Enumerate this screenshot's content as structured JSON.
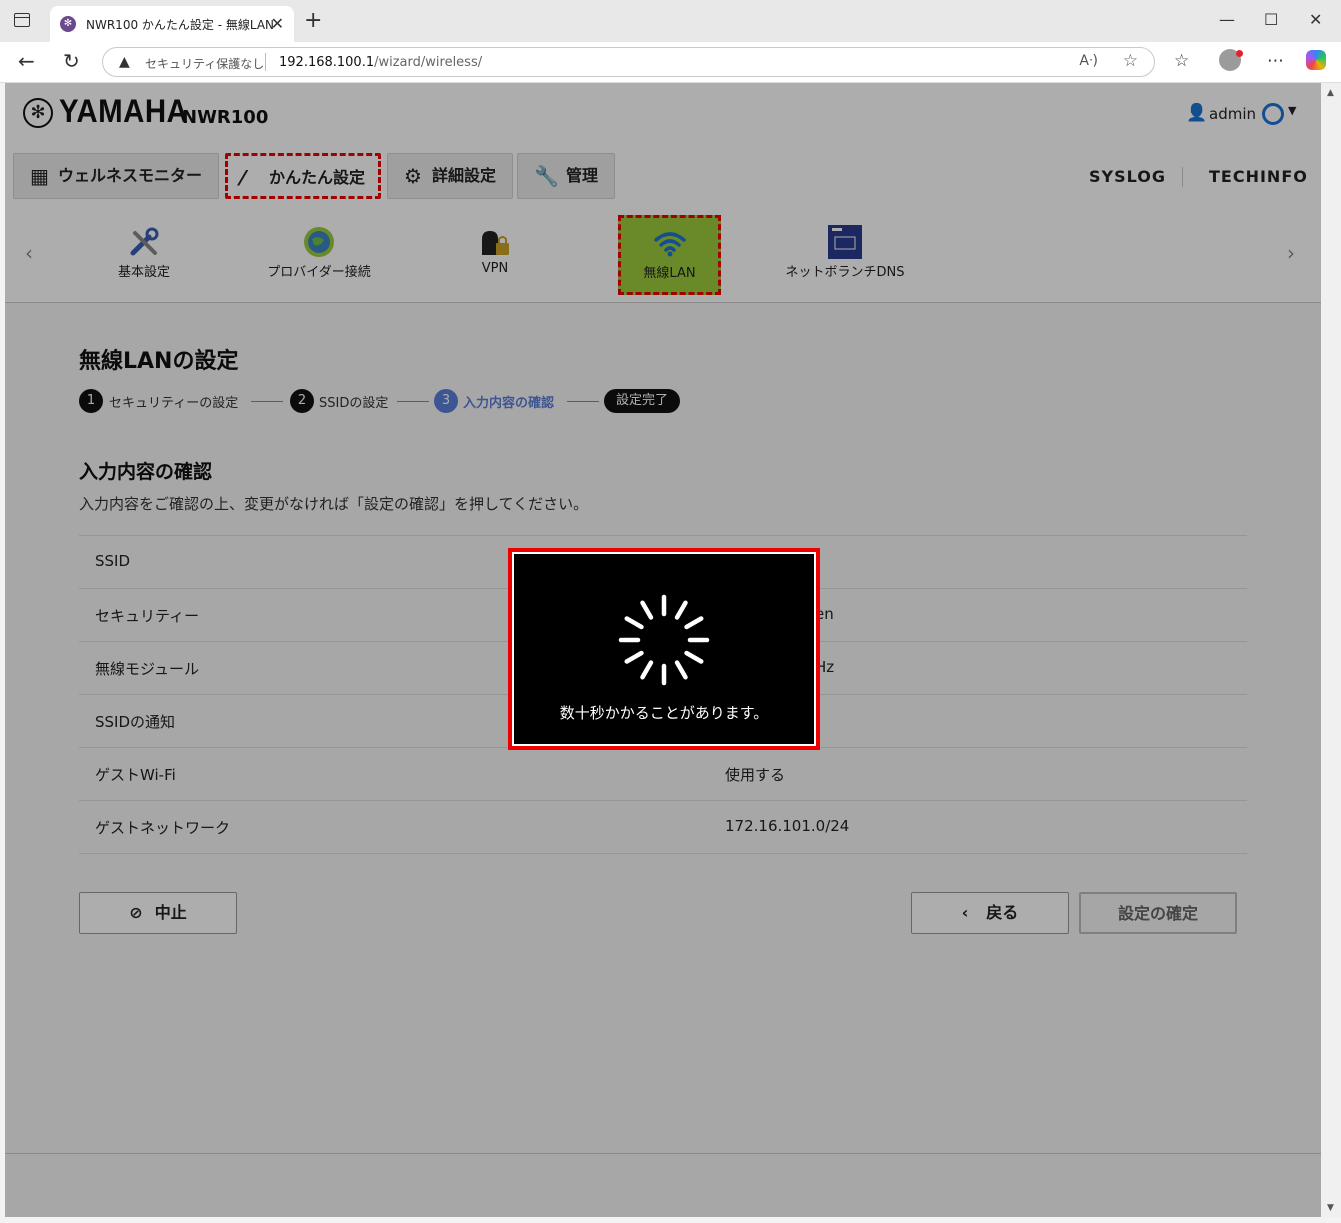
{
  "browser": {
    "tab_title": "NWR100 かんたん設定 - 無線LAN",
    "security_label": "セキュリティ保護なし",
    "url_host": "192.168.100.1",
    "url_path": "/wizard/wireless/"
  },
  "header": {
    "brand": "YAMAHA",
    "model": "NWR100",
    "user": "admin"
  },
  "main_nav": {
    "tabs": [
      {
        "label": "ウェルネスモニター",
        "icon": "dashboard-icon"
      },
      {
        "label": "かんたん設定",
        "icon": "magic-wand-icon",
        "active": true
      },
      {
        "label": "詳細設定",
        "icon": "gear-icon"
      },
      {
        "label": "管理",
        "icon": "wrench-icon"
      }
    ],
    "links": [
      "SYSLOG",
      "TECHINFO"
    ]
  },
  "sub_nav": {
    "items": [
      {
        "label": "基本設定",
        "icon": "tools-icon"
      },
      {
        "label": "プロバイダー接続",
        "icon": "globe-icon"
      },
      {
        "label": "VPN",
        "icon": "vpn-lock-icon"
      },
      {
        "label": "無線LAN",
        "icon": "wifi-icon",
        "active": true
      },
      {
        "label": "ネットボランチDNS",
        "icon": "ddns-service-icon"
      }
    ]
  },
  "wizard": {
    "title": "無線LANの設定",
    "steps": [
      {
        "num": "1",
        "label": "セキュリティーの設定"
      },
      {
        "num": "2",
        "label": "SSIDの設定"
      },
      {
        "num": "3",
        "label": "入力内容の確認",
        "current": true
      }
    ],
    "done_label": "設定完了",
    "section_title": "入力内容の確認",
    "section_desc": "入力内容をご確認の上、変更がなければ「設定の確認」を押してください。",
    "rows": [
      {
        "key": "SSID",
        "value": ""
      },
      {
        "key": "セキュリティー",
        "value": "en"
      },
      {
        "key": "無線モジュール",
        "value": "Hz"
      },
      {
        "key": "SSIDの通知",
        "value": ""
      },
      {
        "key": "ゲストWi-Fi",
        "value": "使用する"
      },
      {
        "key": "ゲストネットワーク",
        "value": "172.16.101.0/24"
      }
    ],
    "buttons": {
      "cancel": "中止",
      "back": "戻る",
      "confirm": "設定の確定"
    }
  },
  "loader": {
    "message": "数十秒かかることがあります。"
  },
  "colors": {
    "highlight": "#e00000",
    "active_sub": "#9ccb3b",
    "step_current": "#5b7ed8"
  }
}
